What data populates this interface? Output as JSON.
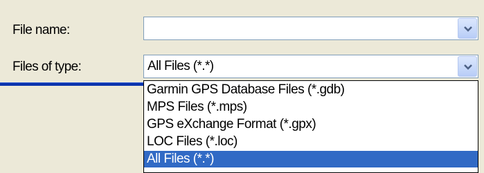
{
  "dialog": {
    "file_name_label": "File name:",
    "file_name_value": "",
    "files_of_type_label": "Files of type:",
    "files_of_type_value": "All Files (*.*)"
  },
  "dropdown": {
    "options": [
      "Garmin GPS Database Files (*.gdb)",
      "MPS Files (*.mps)",
      "GPS eXchange Format (*.gpx)",
      "LOC Files (*.loc)",
      "All Files (*.*)"
    ],
    "selected": "All Files (*.*)"
  },
  "icons": {
    "combo_arrow": "chevron-down-icon"
  },
  "colors": {
    "background": "#ece9d8",
    "selection": "#316ac5",
    "combo_border": "#7f9db9",
    "accent_bar": "#0a33ad"
  }
}
